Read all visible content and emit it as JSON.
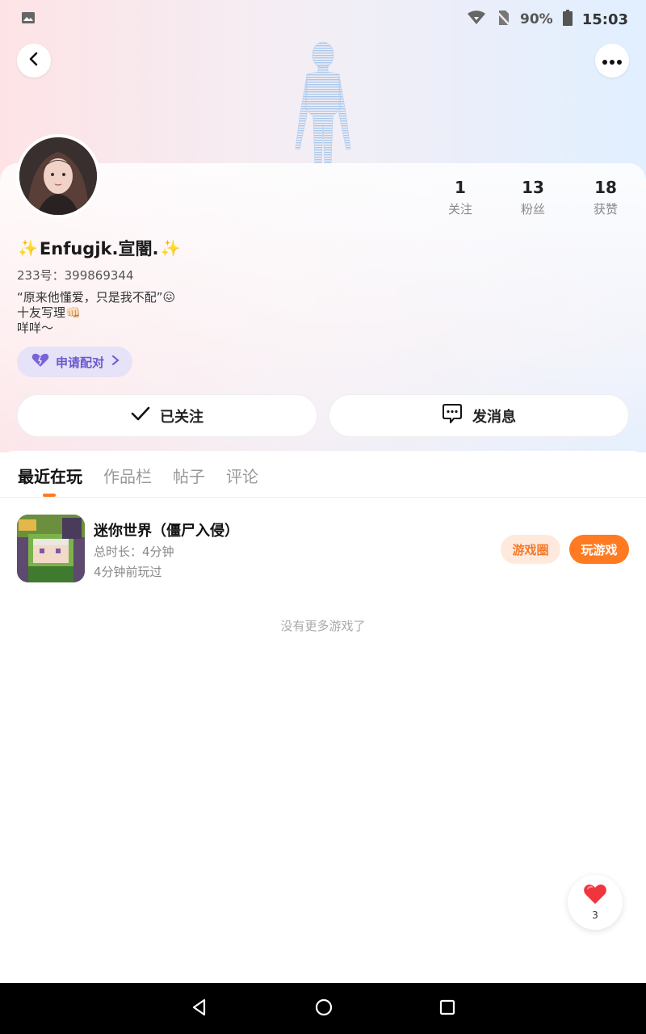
{
  "status_bar": {
    "battery": "90%",
    "time": "15:03",
    "icons": [
      "image-icon",
      "wifi-icon",
      "no-sim-icon",
      "battery-icon"
    ]
  },
  "header": {
    "back_icon": "chevron-left-icon",
    "more_icon": "more-horizontal-icon"
  },
  "profile": {
    "stats": [
      {
        "value": "1",
        "label": "关注"
      },
      {
        "value": "13",
        "label": "粉丝"
      },
      {
        "value": "18",
        "label": "获赞"
      }
    ],
    "name": "Enfugjk.宣闇.",
    "sparkle": "✨",
    "uid": "233号：399869344",
    "bio": [
      "“原来他懂爱，只是我不配”😖",
      "十友写理👊🏻",
      "咩咩～"
    ],
    "match_label": "申请配对"
  },
  "actions": {
    "follow_label": "已关注",
    "message_label": "发消息"
  },
  "tabs": [
    "最近在玩",
    "作品栏",
    "帖子",
    "评论"
  ],
  "games": [
    {
      "title": "迷你世界（僵尸入侵）",
      "duration": "总时长：4分钟",
      "last_played": "4分钟前玩过",
      "circle_label": "游戏圈",
      "play_label": "玩游戏"
    }
  ],
  "empty_text": "没有更多游戏了",
  "like_widget": {
    "count": "3"
  },
  "colors": {
    "accent": "#ff7a21",
    "match_purple": "#6a5acd"
  }
}
